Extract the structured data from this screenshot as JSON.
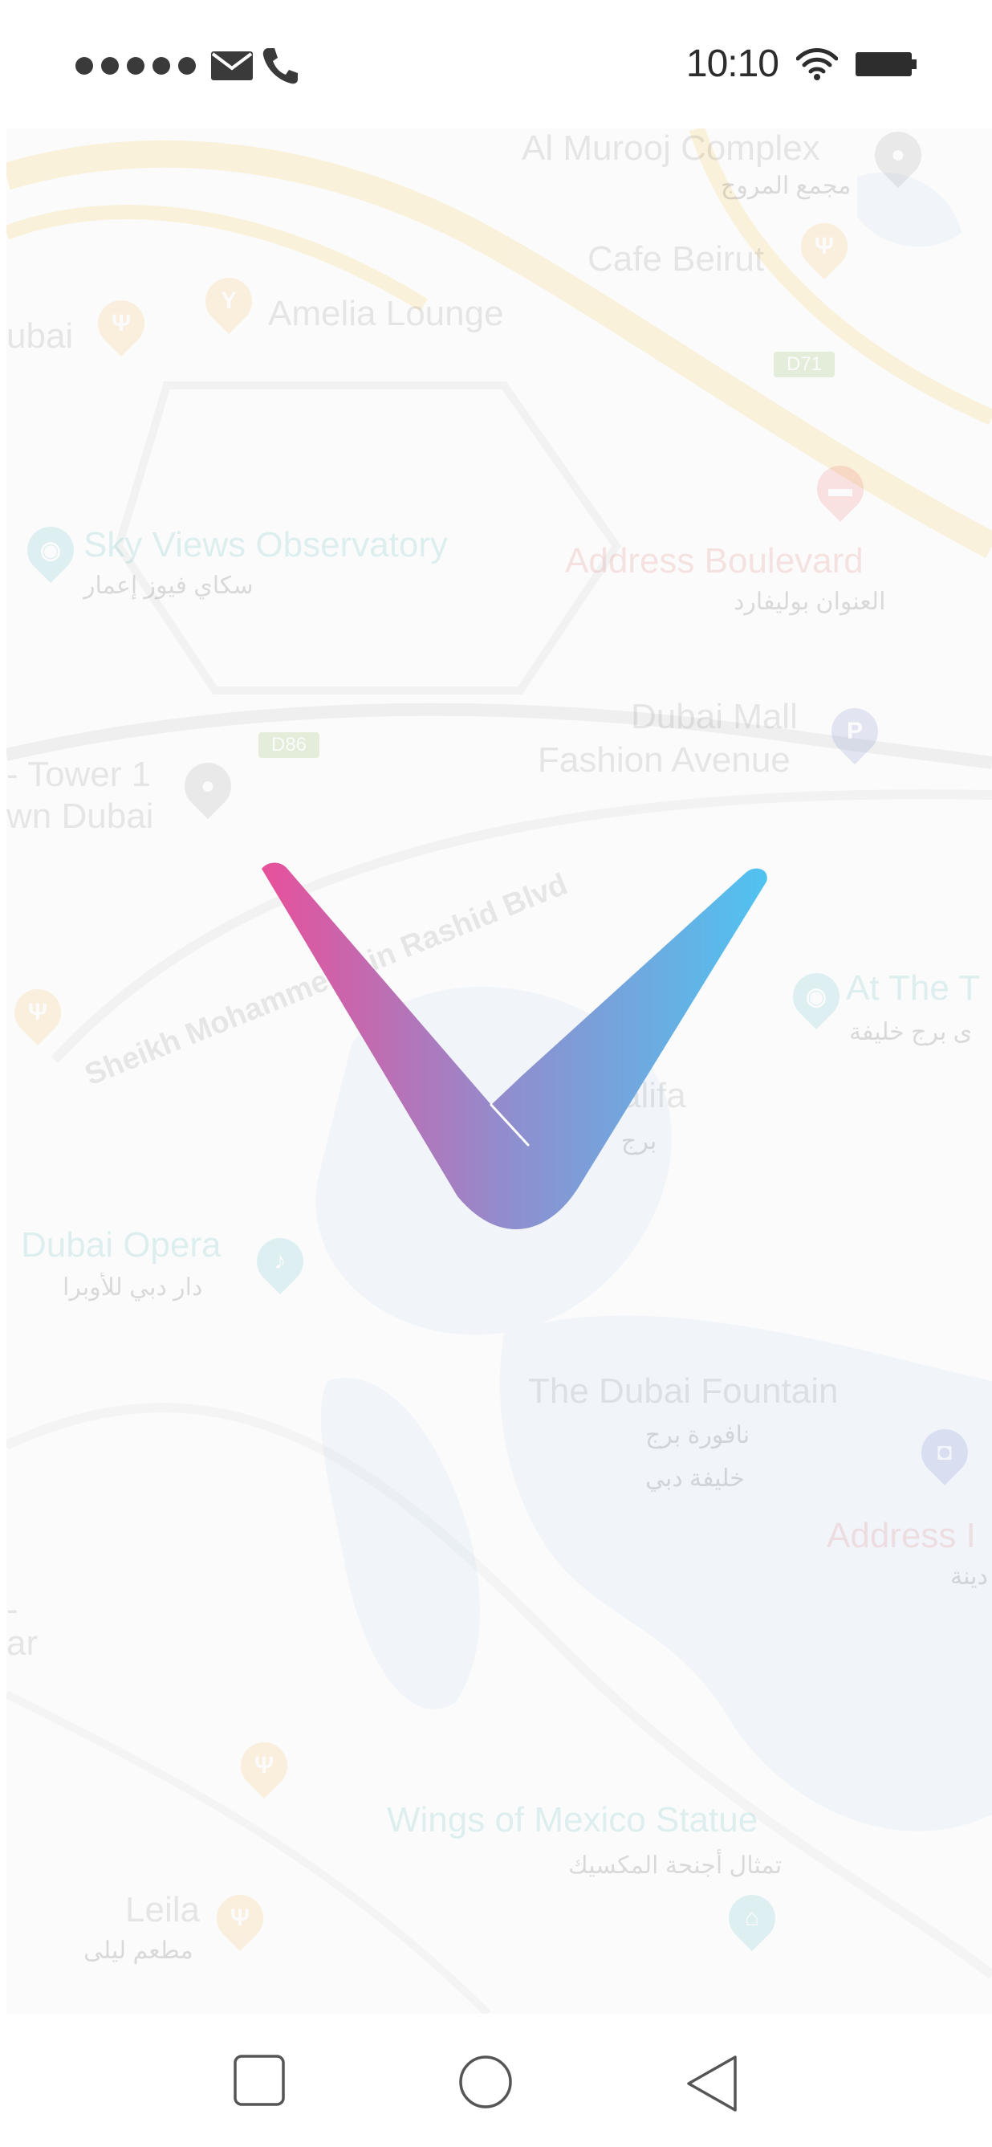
{
  "status_bar": {
    "time": "10:10",
    "signal_dots": 5,
    "icons": [
      "signal-dots-icon",
      "mail-icon",
      "phone-icon",
      "wifi-icon",
      "battery-icon"
    ]
  },
  "map": {
    "labels": {
      "al_murooj": "Al Murooj Complex",
      "al_murooj_ar": "مجمع المروج",
      "cafe_beirut": "Cafe Beirut",
      "amelia": "Amelia Lounge",
      "ubai": "ubai",
      "d71": "D71",
      "sky_views": "Sky Views Observatory",
      "sky_views_ar": "سكاي فيوز إعمار",
      "address_blvd": "Address Boulevard",
      "address_blvd_ar": "العنوان بوليفارد",
      "d86": "D86",
      "tower1": "- Tower 1",
      "town_dubai": "wn Dubai",
      "dubai_mall": "Dubai Mall",
      "fashion_ave": "Fashion Avenue",
      "road_name": "Sheikh Mohammed bin Rashid Blvd",
      "at_the_top": "At The T",
      "at_the_top_ar": "ى برج خليفة",
      "khalifa": "alifa",
      "khalifa_ar": "برج",
      "dubai_opera": "Dubai Opera",
      "dubai_opera_ar": "دار دبي للأوبرا",
      "fountain": "The Dubai Fountain",
      "fountain_ar1": "نافورة برج",
      "fountain_ar2": "خليفة دبي",
      "address_dt": "Address I",
      "address_dt_ar": "دينة",
      "left_edge1": "-",
      "left_edge2": "ar",
      "wings": "Wings of Mexico Statue",
      "wings_ar": "تمثال أجنحة المكسيك",
      "leila": "Leila",
      "leila_ar": "مطعم ليلى"
    }
  },
  "logo": {
    "name": "app-logo-check",
    "gradient_start": "#e8509a",
    "gradient_mid": "#8e8fcf",
    "gradient_end": "#4fc3f0"
  },
  "nav_bar": {
    "buttons": [
      "recent-apps-button",
      "home-button",
      "back-button"
    ]
  }
}
